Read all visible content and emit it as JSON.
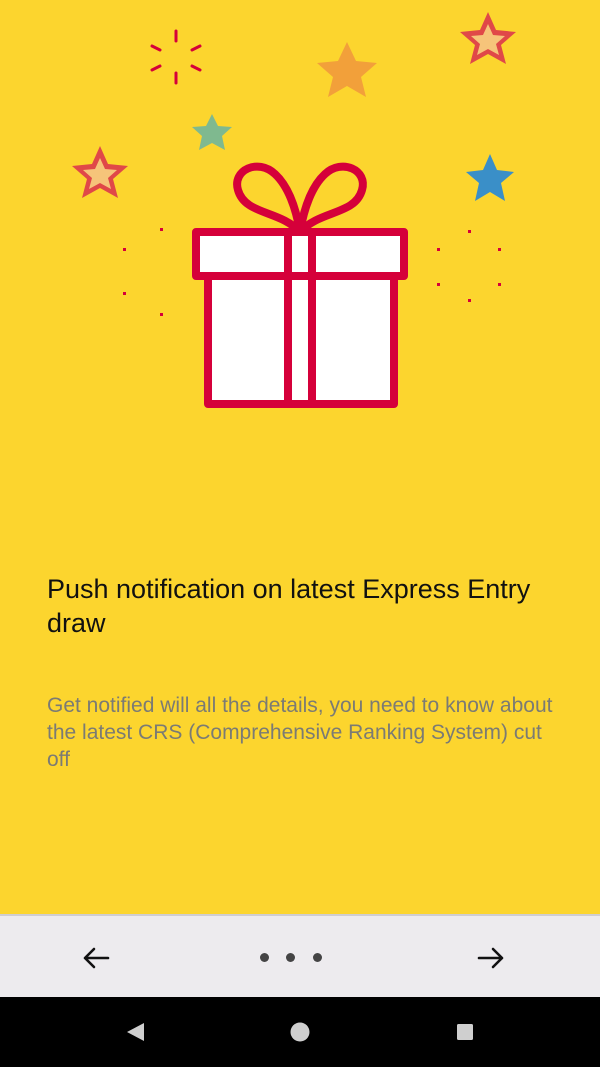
{
  "onboarding": {
    "title": "Push notification on latest Express Entry draw",
    "description": "Get notified will all the details, you need to know about the latest CRS (Comprehensive Ranking System) cut off"
  },
  "colors": {
    "background": "#FCD52E",
    "gift_outline": "#D5003A",
    "gift_fill": "#FFFFFF",
    "star_red": "#E03B3A",
    "star_orange": "#F2A03A",
    "star_green": "#7FB98F",
    "star_blue": "#3A8FC8",
    "nav_bar": "#EDEBEE",
    "system_bar": "#000000"
  },
  "icons": {
    "prev": "arrow-left-icon",
    "next": "arrow-right-icon",
    "back": "triangle-back-icon",
    "home": "circle-home-icon",
    "recents": "square-recents-icon"
  },
  "pager": {
    "total_pages": 3
  }
}
